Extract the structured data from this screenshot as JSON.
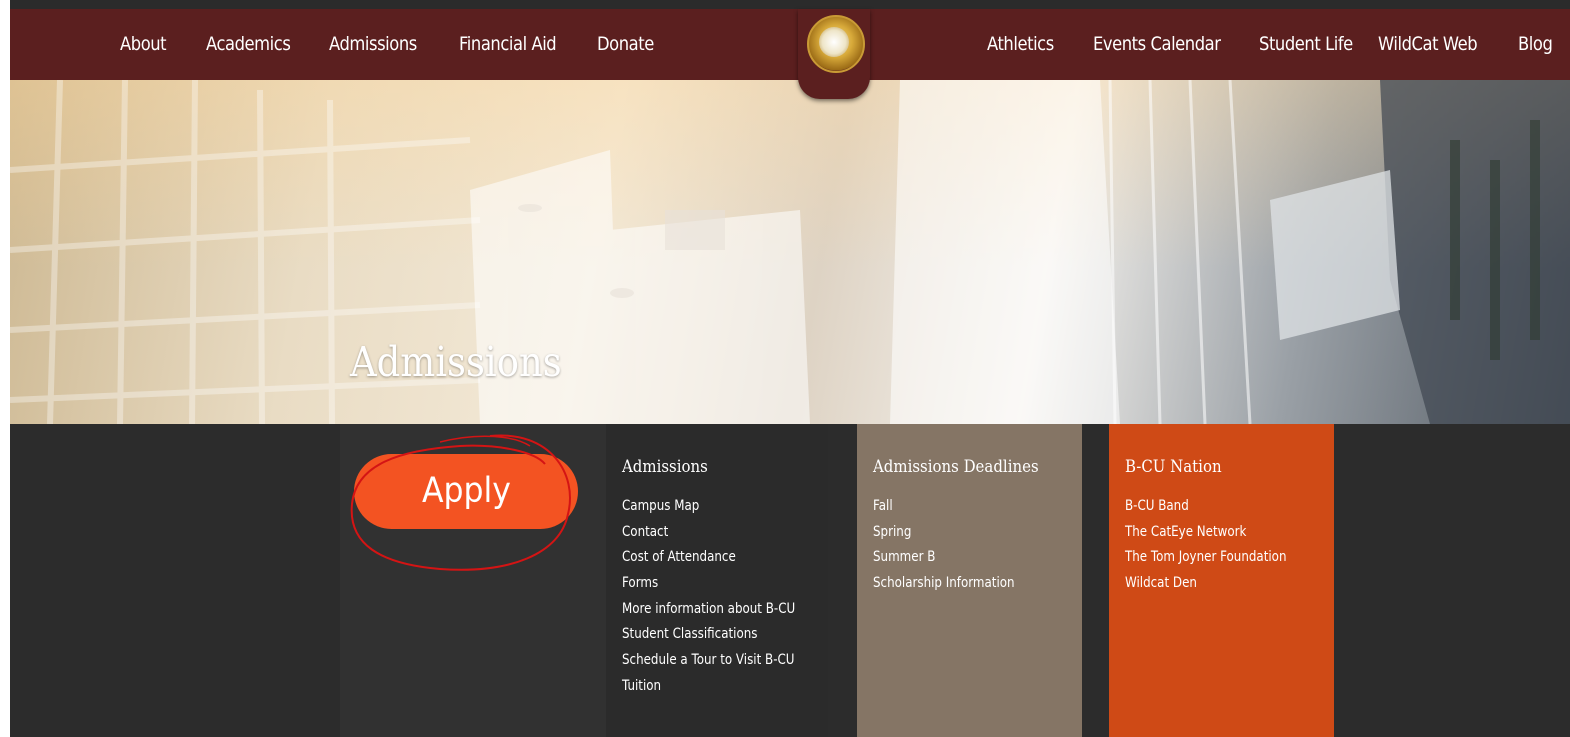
{
  "nav": {
    "left_links": [
      "About",
      "Academics",
      "Admissions",
      "Financial Aid",
      "Donate"
    ],
    "right_links": [
      "Athletics",
      "Events Calendar",
      "Student Life",
      "WildCat Web",
      "Blog"
    ],
    "colors": {
      "bar": "#5b1f1f",
      "text": "#ffffff"
    },
    "seal_icon": "university-seal-icon"
  },
  "hero": {
    "title": "Admissions"
  },
  "apply": {
    "label": "Apply",
    "color": "#f35322",
    "annotation_color": "#d41414"
  },
  "panels": {
    "admissions": {
      "heading": "Admissions",
      "links": [
        "Campus Map",
        "Contact",
        "Cost of Attendance",
        "Forms",
        "More information about B-CU",
        "Student Classifications",
        "Schedule a Tour to Visit B-CU",
        "Tuition"
      ],
      "color": "#2b2b2b"
    },
    "deadlines": {
      "heading": "Admissions Deadlines",
      "links": [
        "Fall",
        "Spring",
        "Summer B",
        "Scholarship Information"
      ],
      "color": "#857565"
    },
    "nation": {
      "heading": "B-CU Nation",
      "links": [
        "B-CU Band",
        "The CatEye Network",
        "The Tom Joyner Foundation",
        "Wildcat Den"
      ],
      "color": "#cf4a16"
    }
  }
}
